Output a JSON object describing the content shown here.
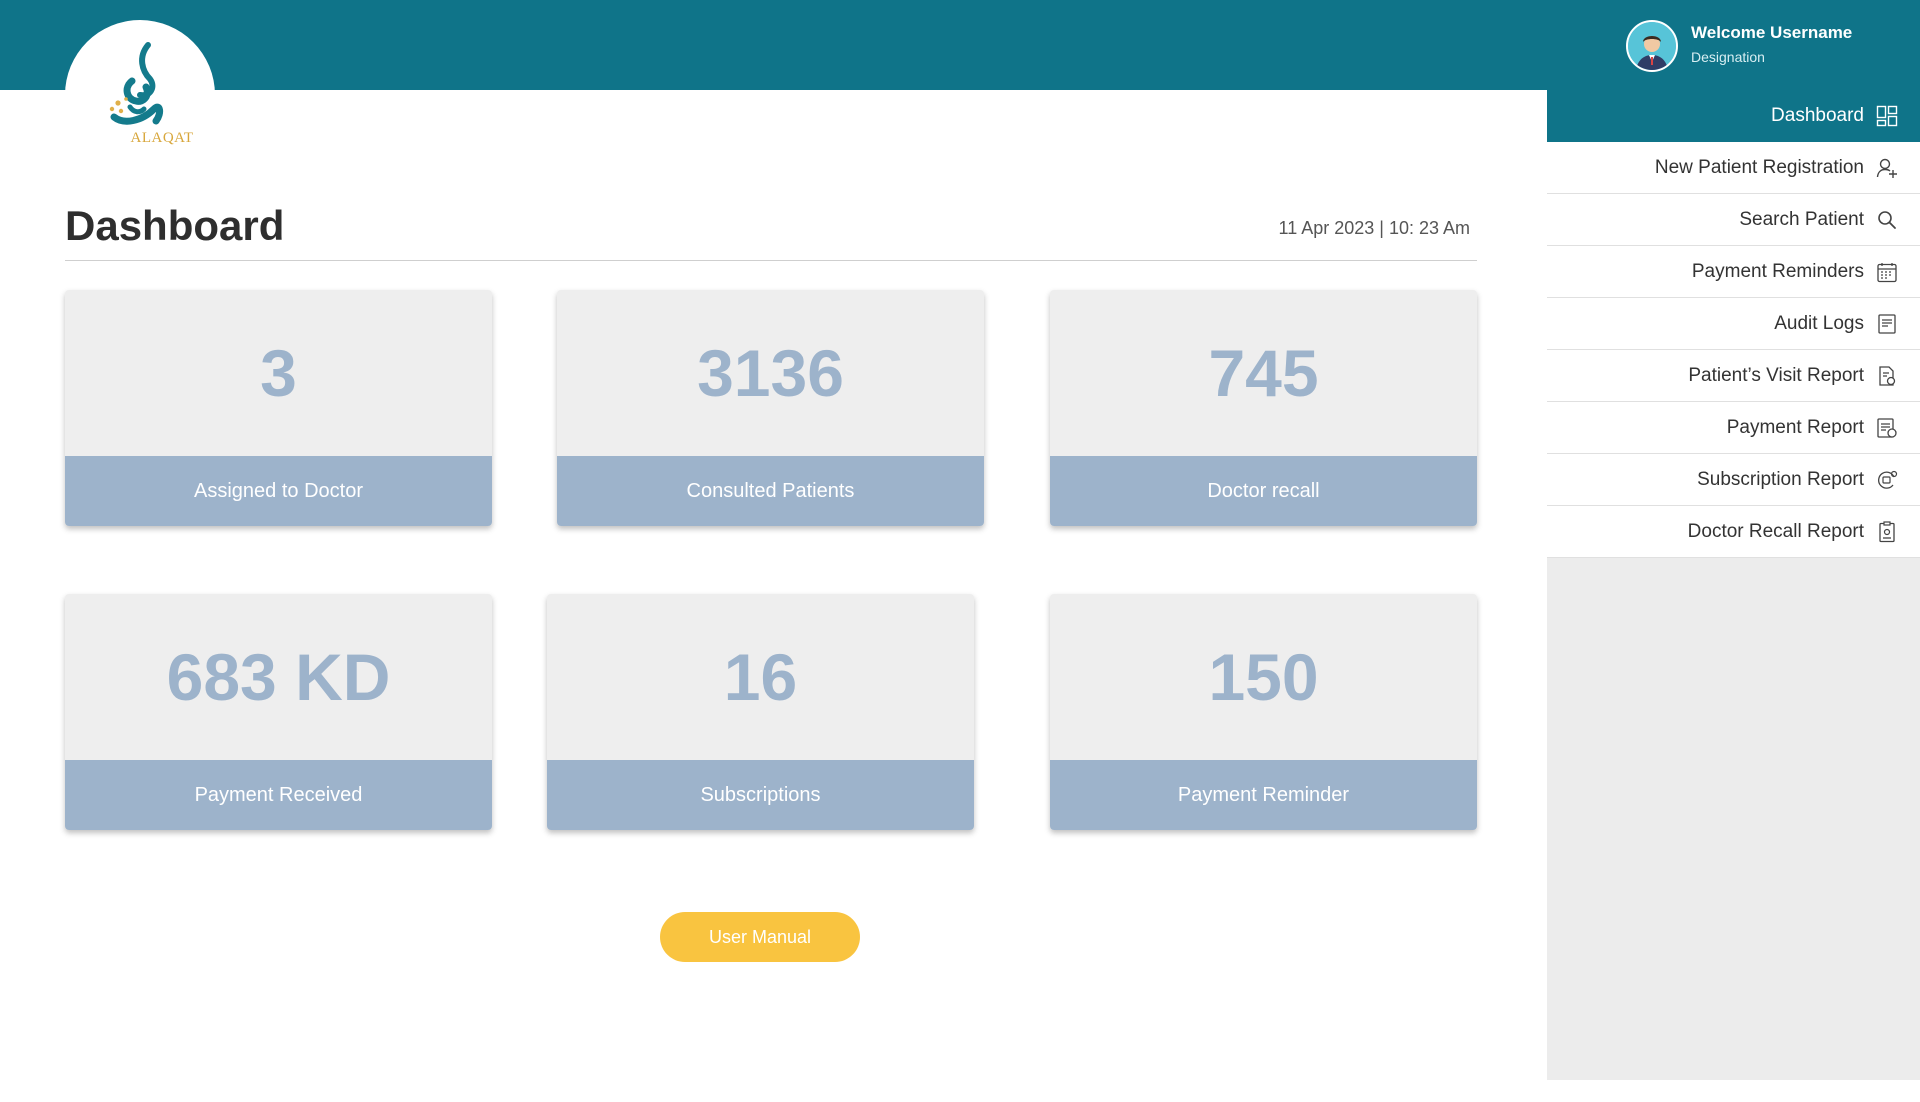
{
  "app": {
    "logo_text": "ALAQAT",
    "accent_color": "#0f7489",
    "card_color": "#9db3cb",
    "button_color": "#f9c440"
  },
  "user": {
    "welcome": "Welcome Username",
    "designation": "Designation",
    "avatar_icon": "user-avatar-icon"
  },
  "main": {
    "title": "Dashboard",
    "datetime": "11 Apr 2023 | 10: 23 Am",
    "cards": [
      {
        "value": "3",
        "label": "Assigned to Doctor"
      },
      {
        "value": "3136",
        "label": "Consulted Patients"
      },
      {
        "value": "745",
        "label": "Doctor recall"
      },
      {
        "value": "683 KD",
        "label": "Payment Received"
      },
      {
        "value": "16",
        "label": "Subscriptions"
      },
      {
        "value": "150",
        "label": "Payment Reminder"
      }
    ],
    "manual_button": "User Manual"
  },
  "sidebar": {
    "items": [
      {
        "label": "Dashboard",
        "icon": "dashboard-grid-icon",
        "active": true
      },
      {
        "label": "New Patient Registration",
        "icon": "user-add-icon"
      },
      {
        "label": "Search Patient",
        "icon": "search-icon"
      },
      {
        "label": "Payment Reminders",
        "icon": "calendar-icon"
      },
      {
        "label": "Audit Logs",
        "icon": "document-list-icon"
      },
      {
        "label": "Patient’s Visit Report",
        "icon": "report-clip-icon"
      },
      {
        "label": "Payment Report",
        "icon": "payment-report-icon"
      },
      {
        "label": "Subscription Report",
        "icon": "subscription-icon"
      },
      {
        "label": "Doctor Recall Report",
        "icon": "clipboard-icon"
      }
    ]
  }
}
